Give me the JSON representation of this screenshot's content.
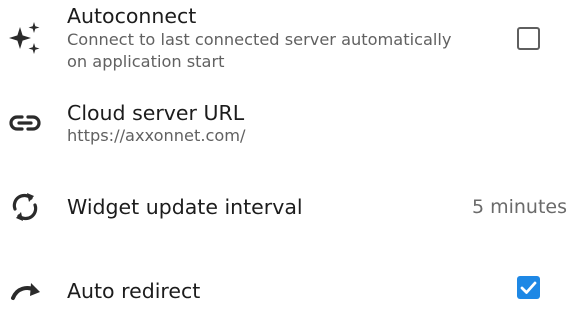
{
  "settings": [
    {
      "id": "autoconnect",
      "icon": "sparkles-icon",
      "title": "Autoconnect",
      "subtitle_line1": "Connect to last connected server automatically",
      "subtitle_line2": "on application start",
      "checked": false
    },
    {
      "id": "cloud-server-url",
      "icon": "link-icon",
      "title": "Cloud server URL",
      "subtitle": "https://axxonnet.com/"
    },
    {
      "id": "widget-update-interval",
      "icon": "sync-arrows-icon",
      "title": "Widget update interval",
      "value": "5 minutes"
    },
    {
      "id": "auto-redirect",
      "icon": "redirect-arrow-icon",
      "title": "Auto redirect",
      "checked": true
    }
  ],
  "colors": {
    "accent": "#1e88e5",
    "icon": "#2b2b2b",
    "subtitle": "#616161"
  }
}
